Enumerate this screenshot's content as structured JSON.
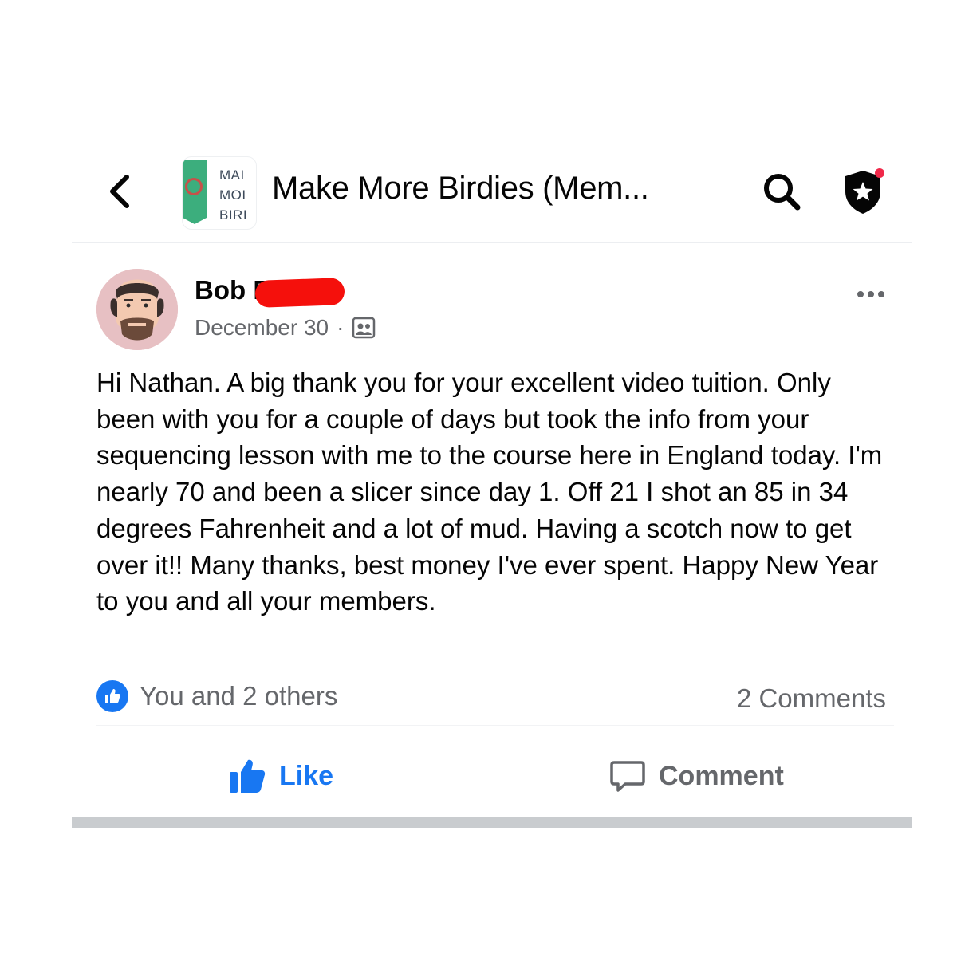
{
  "header": {
    "back_icon": "chevron-left-icon",
    "group_thumb_lines": [
      "MAI",
      "MOI",
      "BIRI"
    ],
    "title": "Make More Birdies (Mem...",
    "search_icon": "search-icon",
    "admin_icon": "shield-star-icon",
    "notification_dot_color": "#f02849"
  },
  "post": {
    "author": "Bob B",
    "date": "December 30",
    "separator": "·",
    "audience_icon": "group-members-icon",
    "more_icon": "more-horizontal-icon",
    "body": "Hi Nathan. A big thank you for your excellent video tuition. Only been with you for a couple of days but took the info from your sequencing lesson with me to the course here in England today. I'm nearly 70 and been a slicer since day 1. Off 21 I shot an 85 in 34 degrees Fahrenheit and a lot of mud. Having a scotch now to get over it!! Many thanks, best money I've ever spent. Happy New Year to you and all your members.",
    "reactions_text": "You and 2 others",
    "comments_text": "2 Comments"
  },
  "actions": {
    "like_label": "Like",
    "comment_label": "Comment"
  },
  "colors": {
    "accent": "#1877f2",
    "secondary_text": "#65676b",
    "redaction": "#f5100c"
  }
}
